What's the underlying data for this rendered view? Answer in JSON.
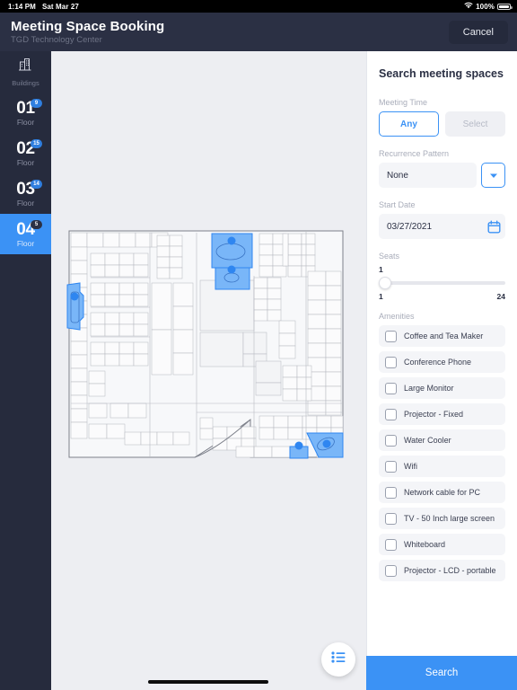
{
  "statusbar": {
    "time": "1:14 PM",
    "date": "Sat Mar 27",
    "battery_pct": "100%",
    "wifi_icon": "wifi-icon",
    "battery_icon": "battery-icon"
  },
  "header": {
    "title": "Meeting Space Booking",
    "subtitle": "TGD Technology Center",
    "cancel_label": "Cancel"
  },
  "sidebar": {
    "buildings_label": "Buildings",
    "buildings_icon": "buildings-icon",
    "floors": [
      {
        "number": "01",
        "word": "Floor",
        "badge": "9",
        "selected": false
      },
      {
        "number": "02",
        "word": "Floor",
        "badge": "15",
        "selected": false
      },
      {
        "number": "03",
        "word": "Floor",
        "badge": "14",
        "selected": false
      },
      {
        "number": "04",
        "word": "Floor",
        "badge": "5",
        "selected": true
      }
    ]
  },
  "map": {
    "background_color": "#edeef2",
    "highlight_color": "#6cb0f7",
    "marker_color": "#2f86f0",
    "fab_icon": "list-view-icon",
    "highlighted_rooms": 5
  },
  "panel": {
    "title": "Search meeting spaces",
    "meeting_time": {
      "label": "Meeting Time",
      "options": [
        {
          "label": "Any",
          "selected": true
        },
        {
          "label": "Select",
          "selected": false
        }
      ]
    },
    "recurrence": {
      "label": "Recurrence Pattern",
      "value": "None",
      "caret_icon": "chevron-down-icon"
    },
    "start_date": {
      "label": "Start Date",
      "value": "03/27/2021",
      "calendar_icon": "calendar-icon"
    },
    "seats": {
      "label": "Seats",
      "value": "1",
      "min": "1",
      "max": "24"
    },
    "amenities": {
      "label": "Amenities",
      "items": [
        {
          "label": "Coffee and Tea Maker",
          "checked": false
        },
        {
          "label": "Conference Phone",
          "checked": false
        },
        {
          "label": "Large Monitor",
          "checked": false
        },
        {
          "label": "Projector - Fixed",
          "checked": false
        },
        {
          "label": "Water Cooler",
          "checked": false
        },
        {
          "label": "Wifi",
          "checked": false
        },
        {
          "label": "Network cable for PC",
          "checked": false
        },
        {
          "label": "TV - 50 Inch large screen",
          "checked": false
        },
        {
          "label": "Whiteboard",
          "checked": false
        },
        {
          "label": "Projector - LCD - portable",
          "checked": false
        }
      ]
    },
    "search_label": "Search"
  },
  "colors": {
    "accent": "#3b92f5",
    "header_bg": "#2b3044",
    "sidebar_bg": "#262b3d"
  }
}
